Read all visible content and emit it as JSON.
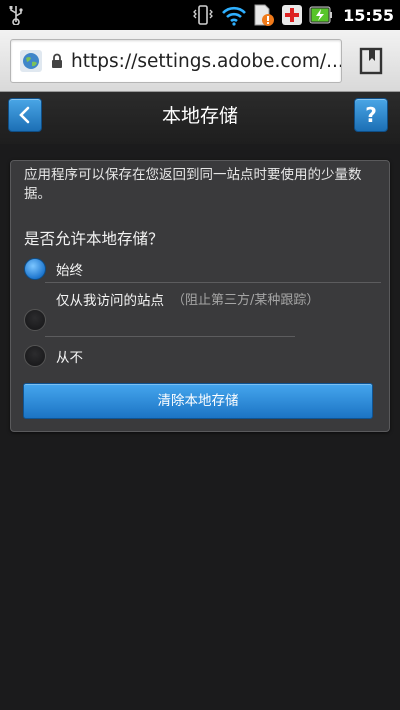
{
  "status_bar": {
    "time": "15:55",
    "icons": [
      "usb-icon",
      "vibrate-icon",
      "wifi-icon",
      "sim-warning-icon",
      "first-aid-icon",
      "battery-charging-icon"
    ]
  },
  "browser": {
    "url": "https://settings.adobe.com/...",
    "icons": [
      "globe-icon",
      "lock-icon",
      "bookmarks-icon"
    ]
  },
  "header": {
    "title": "本地存储",
    "help_label": "?"
  },
  "panel": {
    "description": "应用程序可以保存在您返回到同一站点时要使用的少量数据。",
    "question": "是否允许本地存储？",
    "options": [
      {
        "label": "始终",
        "hint": "",
        "selected": true
      },
      {
        "label": "仅从我访问的站点",
        "hint": "（阻止第三方/某种跟踪）",
        "selected": false
      },
      {
        "label": "从不",
        "hint": "",
        "selected": false
      }
    ],
    "clear_button": "清除本地存储"
  },
  "colors": {
    "accent": "#2a8ad8",
    "background": "#1b1b1c",
    "panel": "#3a3a3c"
  }
}
